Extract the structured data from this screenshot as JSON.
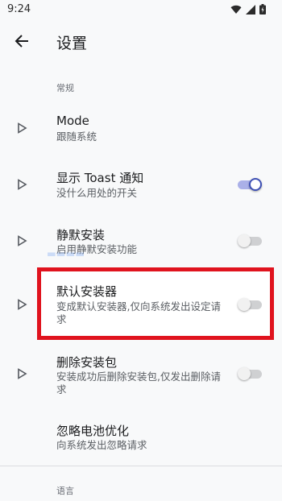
{
  "status_bar": {
    "time": "9:24",
    "icons": [
      "wifi-icon",
      "signal-icon",
      "battery-icon"
    ]
  },
  "app_bar": {
    "back_icon": "arrow-left-icon",
    "title": "设置"
  },
  "sections": [
    {
      "header": "常规"
    },
    {
      "header": "语言"
    }
  ],
  "preferences": [
    {
      "title": "Mode",
      "summary": "跟随系统",
      "has_switch": false
    },
    {
      "title": "显示 Toast 通知",
      "summary": "没什么用处的开关",
      "has_switch": true,
      "checked": true
    },
    {
      "title": "静默安装",
      "summary": "启用静默安装功能",
      "has_switch": true,
      "checked": false
    },
    {
      "title": "默认安装器",
      "summary": "变成默认安装器,仅向系统发出设定请求",
      "has_switch": true,
      "checked": false,
      "highlighted": true
    },
    {
      "title": "删除安装包",
      "summary": "安装成功后删除安装包,仅发出删除请求",
      "has_switch": true,
      "checked": false
    },
    {
      "title": "忽略电池优化",
      "summary": "向系统发出忽略请求",
      "has_switch": false
    }
  ],
  "colors": {
    "accent": "#3f51b5",
    "highlight": "#e0131e",
    "background": "#f8f9fa"
  }
}
